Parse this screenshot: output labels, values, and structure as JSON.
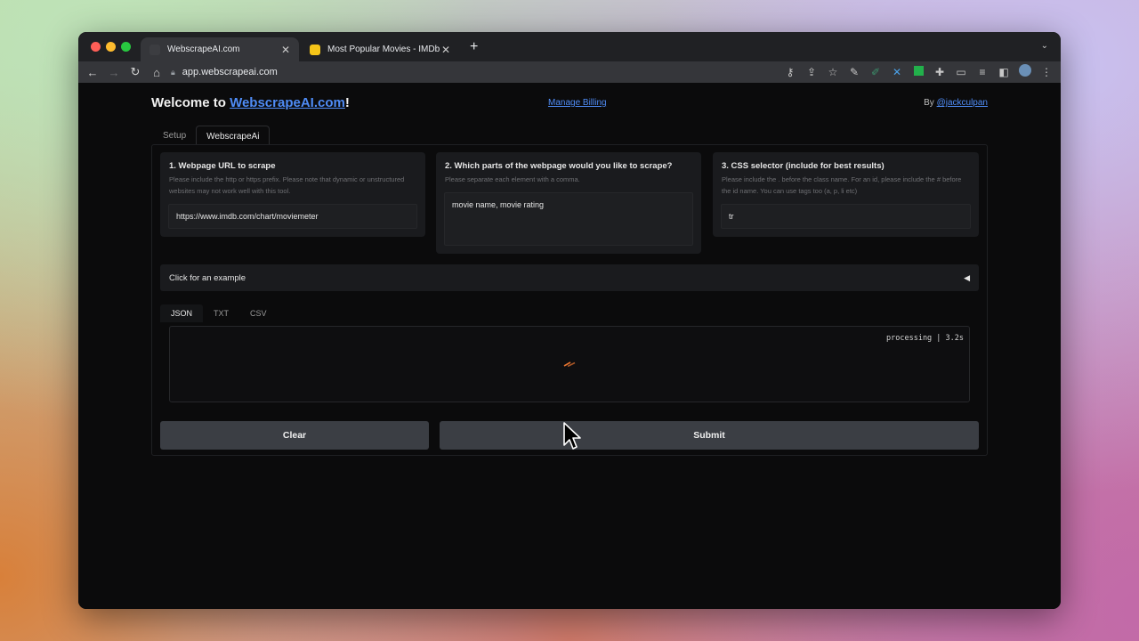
{
  "browser": {
    "tabs": [
      {
        "title": "WebscrapeAI.com",
        "active": true,
        "favicon": "webscrape-favicon"
      },
      {
        "title": "Most Popular Movies - IMDb",
        "active": false,
        "favicon": "imdb-favicon"
      }
    ],
    "close_glyph": "✕",
    "new_tab_glyph": "+",
    "tab_menu_glyph": "⌄",
    "url": "app.webscrapeai.com",
    "nav": {
      "back": "←",
      "forward": "→",
      "reload": "↻",
      "home": "⌂"
    },
    "extensions": [
      "key-icon",
      "share-icon",
      "star-icon",
      "pen-icon",
      "stylus-icon",
      "x-extension-icon",
      "green-extension-icon",
      "puzzle-icon",
      "cast-icon",
      "reading-list-icon",
      "sidepanel-icon",
      "avatar-icon",
      "kebab-icon"
    ]
  },
  "header": {
    "welcome_prefix": "Welcome to ",
    "brand_link": "WebscrapeAI.com",
    "welcome_suffix": "!",
    "billing_link": "Manage Billing",
    "by_prefix": "By ",
    "author_link": "@jackculpan"
  },
  "app_tabs": [
    {
      "label": "Setup",
      "active": false
    },
    {
      "label": "WebscrapeAi",
      "active": true
    }
  ],
  "inputs": {
    "url": {
      "title": "1. Webpage URL to scrape",
      "help": "Please include the http or https prefix. Please note that dynamic or unstructured websites may not work well with this tool.",
      "value": "https://www.imdb.com/chart/moviemeter"
    },
    "parts": {
      "title": "2. Which parts of the webpage would you like to scrape?",
      "help": "Please separate each element with a comma.",
      "value": "movie name, movie rating"
    },
    "selector": {
      "title": "3. CSS selector (include for best results)",
      "help": "Please include the . before the class name. For an id, please include the # before the id name. You can use tags too (a, p, li etc)",
      "value": "tr"
    }
  },
  "examples": {
    "label": "Click for an example",
    "toggle_glyph": "◀"
  },
  "output": {
    "formats": [
      {
        "label": "JSON",
        "active": true
      },
      {
        "label": "TXT",
        "active": false
      },
      {
        "label": "CSV",
        "active": false
      }
    ],
    "status": "processing | 3.2s"
  },
  "buttons": {
    "clear": "Clear",
    "submit": "Submit"
  },
  "colors": {
    "link": "#4f8cf6",
    "spinner": "#e8742f",
    "button": "#3b3e44",
    "card": "#1a1b1e"
  }
}
